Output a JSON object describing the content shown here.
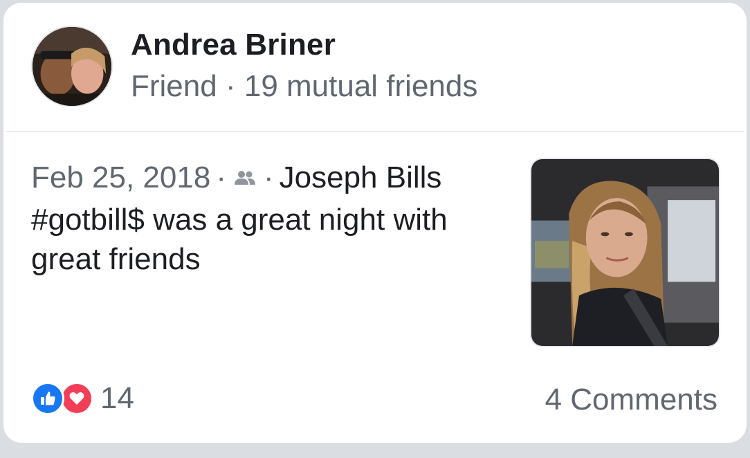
{
  "profile": {
    "name": "Andrea Briner",
    "relationship": "Friend",
    "separator": "·",
    "mutual_friends": "19 mutual friends"
  },
  "post": {
    "date": "Feb 25, 2018",
    "separator": "·",
    "audience_icon": "friends-icon",
    "author": "Joseph Bills",
    "text": "#gotbill$ was a great night with great friends"
  },
  "footer": {
    "reaction_icons": [
      "like-icon",
      "love-icon"
    ],
    "reaction_count": "14",
    "comments": "4 Comments"
  },
  "colors": {
    "like": "#1877f2",
    "love": "#f33e58",
    "secondary_text": "#606770",
    "primary_text": "#1c1e21"
  }
}
